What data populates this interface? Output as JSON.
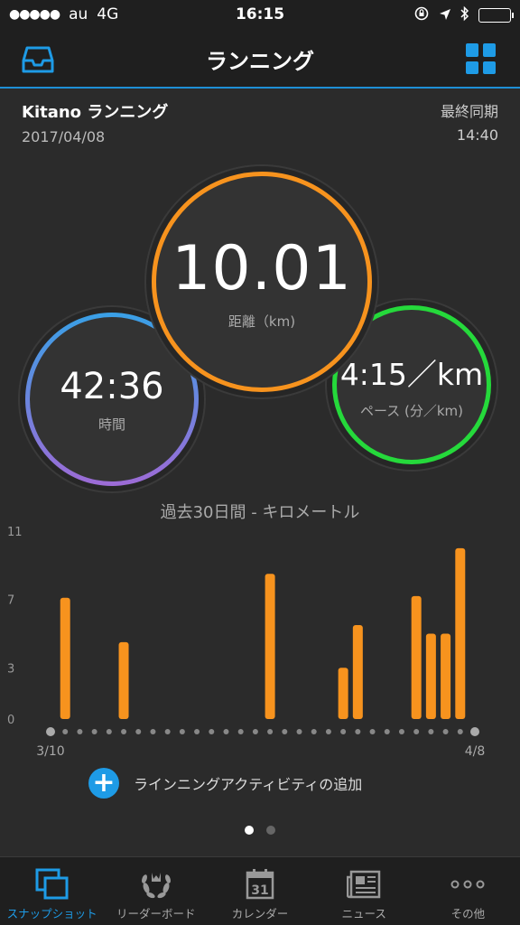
{
  "status_bar": {
    "signal_dots": "●●●●●",
    "carrier": "au",
    "network": "4G",
    "time": "16:15"
  },
  "nav": {
    "title": "ランニング",
    "left_icon": "inbox-icon",
    "right_icon": "grid-icon",
    "accent": "#1e9be6"
  },
  "activity": {
    "name": "Kitano ランニング",
    "date": "2017/04/08",
    "sync_label": "最終同期",
    "sync_time": "14:40"
  },
  "stats": {
    "distance": {
      "value": "10.01",
      "label": "距離（km)",
      "color": "#f7931e"
    },
    "time": {
      "value": "42:36",
      "label": "時間",
      "color": "#39a0e6"
    },
    "pace": {
      "value": "4:15／km",
      "label": "ペース (分／km)",
      "color": "#25d93b"
    }
  },
  "chart_title": "過去30日間 - キロメートル",
  "chart_data": {
    "type": "bar",
    "title": "過去30日間 - キロメートル",
    "ylim": [
      0,
      11
    ],
    "yticks": [
      0,
      3,
      7,
      11
    ],
    "x_start_label": "3/10",
    "x_end_label": "4/8",
    "days": 30,
    "values": [
      0,
      7.1,
      0,
      0,
      0,
      4.5,
      0,
      0,
      0,
      0,
      0,
      0,
      0,
      0,
      0,
      8.5,
      0,
      0,
      0,
      0,
      3.0,
      5.5,
      0,
      0,
      0,
      7.2,
      5.0,
      5.0,
      10.0,
      0
    ],
    "bar_color": "#f7931e"
  },
  "add_activity": {
    "label": "ラインニングアクティビティの追加",
    "icon": "plus-icon"
  },
  "pager": {
    "pages": 2,
    "active": 0
  },
  "tabs": [
    {
      "label": "スナップショット",
      "icon": "snapshot-icon",
      "active": true
    },
    {
      "label": "リーダーボード",
      "icon": "laurel-icon",
      "active": false
    },
    {
      "label": "カレンダー",
      "icon": "calendar-icon",
      "day": "31",
      "active": false
    },
    {
      "label": "ニュース",
      "icon": "news-icon",
      "active": false
    },
    {
      "label": "その他",
      "icon": "more-icon",
      "active": false
    }
  ]
}
